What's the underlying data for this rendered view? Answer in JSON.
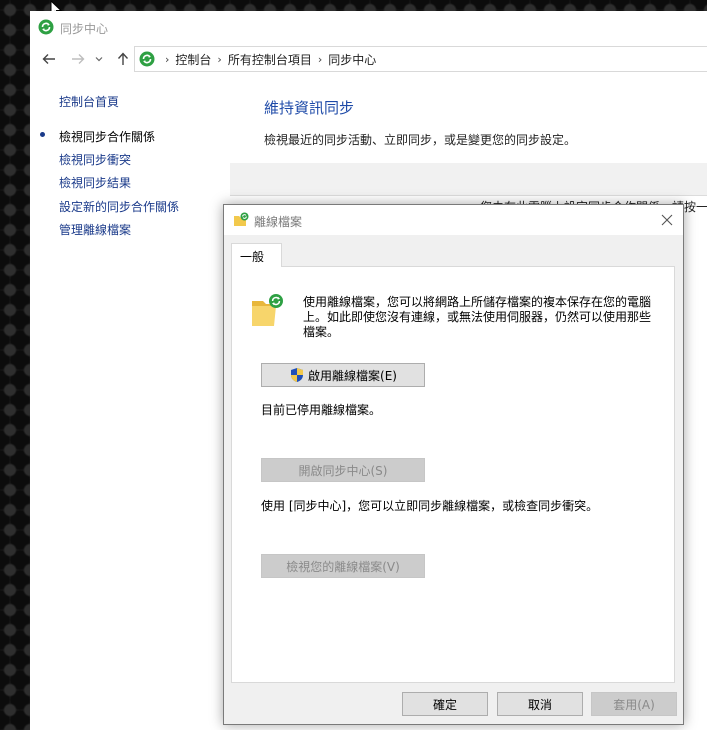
{
  "window": {
    "title": "同步中心"
  },
  "address": {
    "crumbs": [
      "控制台",
      "所有控制台項目",
      "同步中心"
    ]
  },
  "sidebar": {
    "home": "控制台首頁",
    "items": [
      {
        "label": "檢視同步合作關係",
        "active": true
      },
      {
        "label": "檢視同步衝突",
        "active": false
      },
      {
        "label": "檢視同步結果",
        "active": false
      },
      {
        "label": "設定新的同步合作關係",
        "active": false
      },
      {
        "label": "管理離線檔案",
        "active": false
      }
    ]
  },
  "main": {
    "heading": "維持資訊同步",
    "description": "檢視最近的同步活動、立即同步，或是變更您的同步設定。",
    "partial_text": "您未在此電腦上設定同步合作關係。請按一"
  },
  "dialog": {
    "title": "離線檔案",
    "tab": "一般",
    "description": "使用離線檔案，您可以將網路上所儲存檔案的複本保存在您的電腦上。如此即使您沒有連線，或無法使用伺服器，仍然可以使用那些檔案。",
    "enable_button": "啟用離線檔案(E)",
    "status": "目前已停用離線檔案。",
    "open_sync_button": "開啟同步中心(S)",
    "sync_info": "使用 [同步中心]，您可以立即同步離線檔案，或檢查同步衝突。",
    "view_files_button": "檢視您的離線檔案(V)",
    "ok_button": "確定",
    "cancel_button": "取消",
    "apply_button": "套用(A)"
  },
  "colors": {
    "link": "#1a3a8a",
    "heading": "#1e4aa8",
    "sync_green": "#2ea043",
    "folder_yellow": "#f2c94c"
  },
  "icons": [
    "sync-center-icon",
    "back-arrow-icon",
    "forward-arrow-icon",
    "recent-dropdown-icon",
    "up-arrow-icon",
    "offline-files-icon",
    "close-icon",
    "uac-shield-icon",
    "mouse-cursor-icon"
  ]
}
